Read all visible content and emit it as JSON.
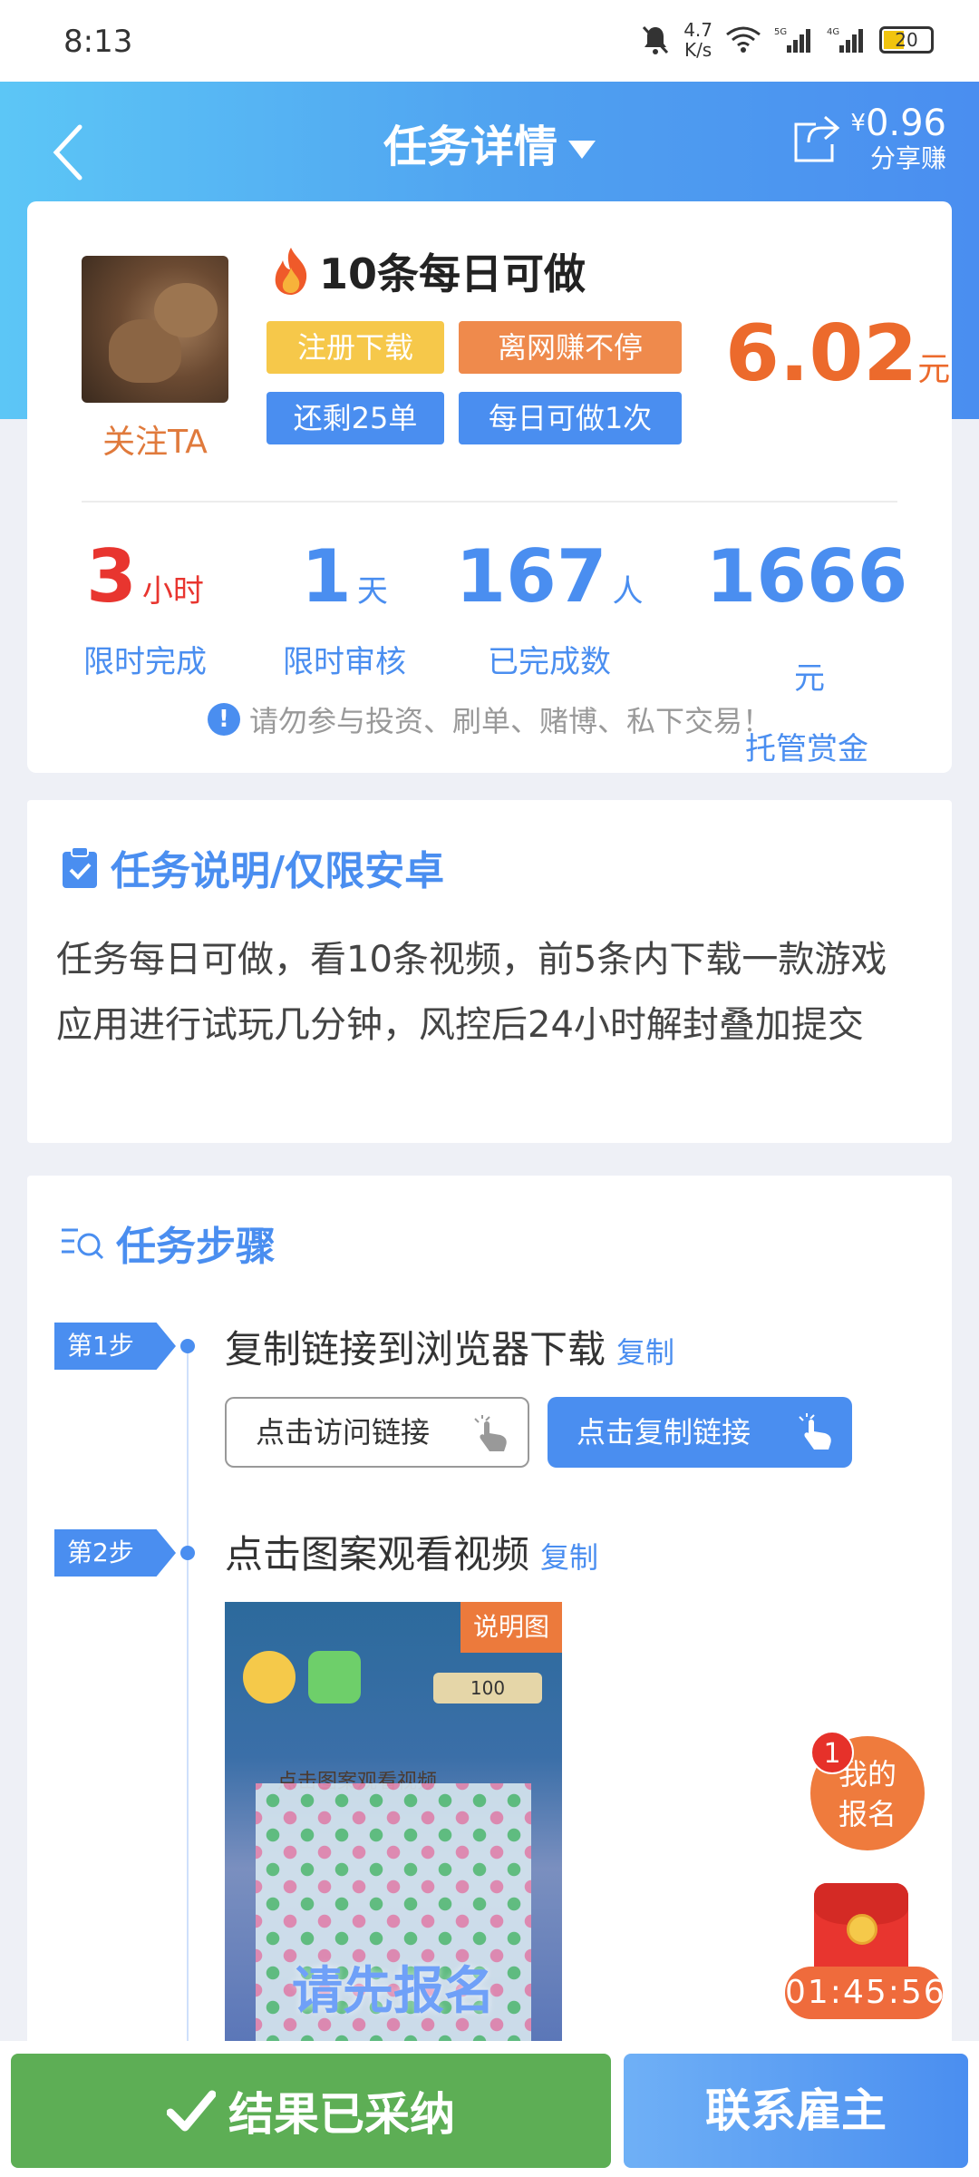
{
  "status_bar": {
    "time": "8:13",
    "speed_value": "4.7",
    "speed_unit": "K/s",
    "battery": "20"
  },
  "header": {
    "title": "任务详情",
    "share_amount": "0.96",
    "share_currency": "¥",
    "share_label": "分享赚"
  },
  "task": {
    "title": "10条每日可做",
    "follow_label": "关注TA",
    "tags": [
      "注册下载",
      "离网赚不停",
      "还剩25单",
      "每日可做1次"
    ],
    "price": "6.02",
    "price_unit": "元"
  },
  "stats": [
    {
      "value": "3",
      "unit": "小时",
      "label": "限时完成"
    },
    {
      "value": "1",
      "unit": "天",
      "label": "限时审核"
    },
    {
      "value": "167",
      "unit": "人",
      "label": "已完成数"
    },
    {
      "value": "1666",
      "unit": "元",
      "label": "托管赏金"
    }
  ],
  "warning": "请勿参与投资、刷单、赌博、私下交易！",
  "description": {
    "heading": "任务说明/仅限安卓",
    "text": "任务每日可做，看10条视频，前5条内下载一款游戏应用进行试玩几分钟，风控后24小时解封叠加提交"
  },
  "steps": {
    "heading": "任务步骤",
    "items": [
      {
        "badge": "第1步",
        "text": "复制链接到浏览器下载",
        "copy": "复制",
        "btn_visit": "点击访问链接",
        "btn_copy": "点击复制链接"
      },
      {
        "badge": "第2步",
        "text": "点击图案观看视频",
        "copy": "复制",
        "image_tag": "说明图",
        "image_caption": "点击图案观看视频",
        "image_counter": "100",
        "image_overlay": "请先报名"
      }
    ]
  },
  "floating": {
    "my_signup": "我的报名",
    "signup_line1": "我的",
    "signup_line2": "报名",
    "badge_count": "1",
    "countdown": "01:45:56"
  },
  "bottom": {
    "accepted": "结果已采纳",
    "contact": "联系雇主"
  },
  "colors": {
    "primary_blue": "#4a8ef0",
    "orange": "#ec6a2c",
    "red": "#e8352f",
    "green": "#5dae55",
    "yellow_tag": "#f6c84a"
  }
}
